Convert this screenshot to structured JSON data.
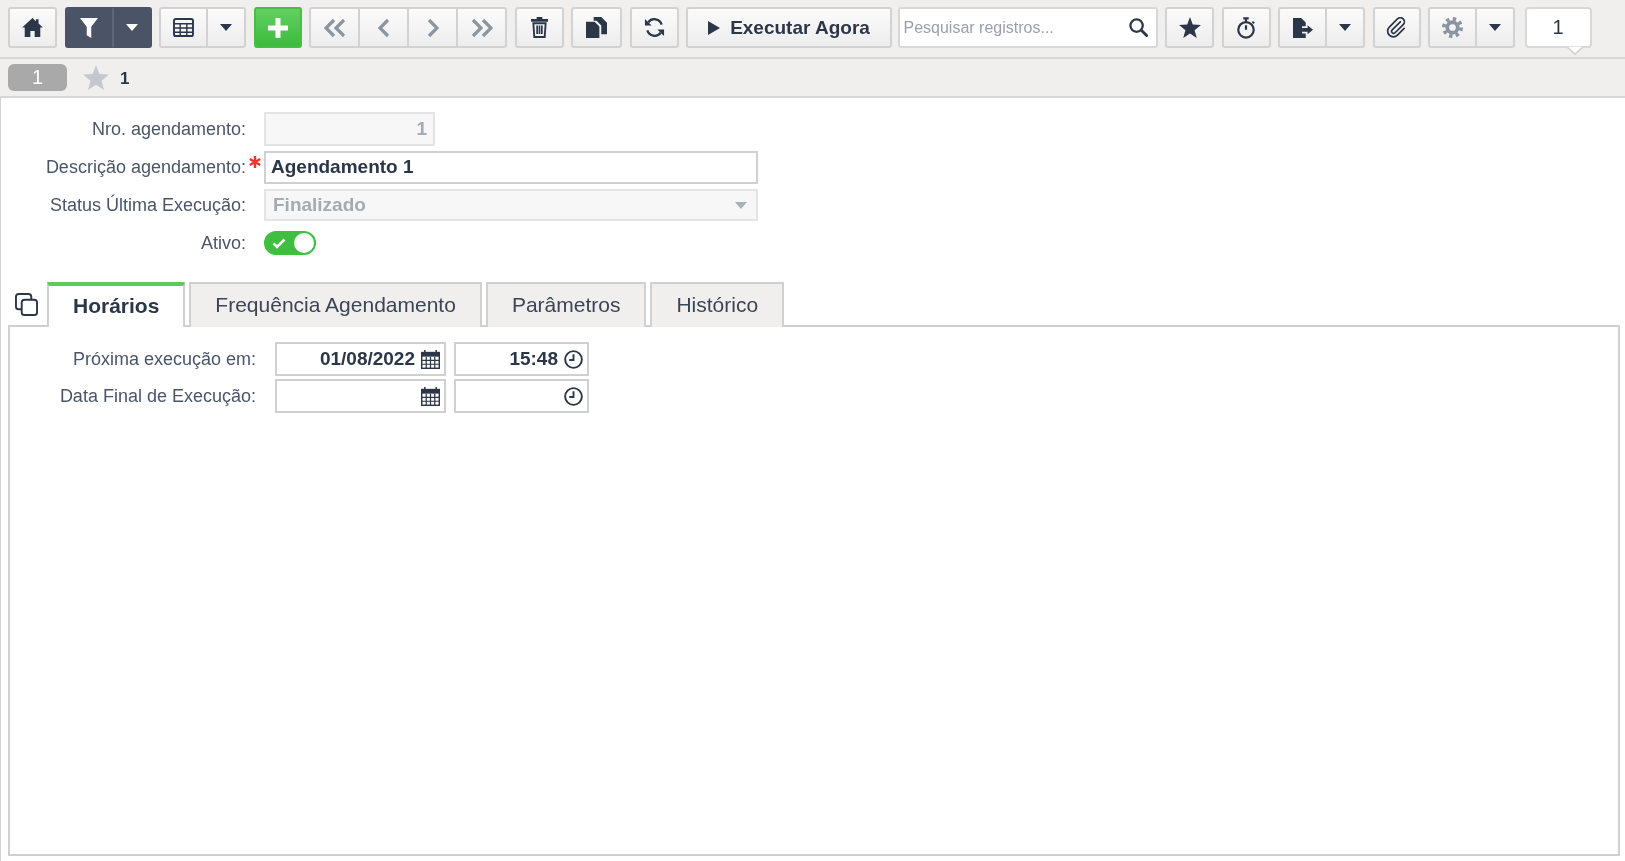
{
  "toolbar": {
    "filter_active": true,
    "run_button": {
      "label": "Executar Agora"
    },
    "search": {
      "placeholder": "Pesquisar registros..."
    },
    "record_counter": "1"
  },
  "record_bar": {
    "record_badge": "1",
    "favorites_count": "1"
  },
  "form": {
    "fields": [
      {
        "kind": "number",
        "label": "Nro. agendamento:",
        "value": "1",
        "disabled": true,
        "required": false
      },
      {
        "kind": "text",
        "label": "Descrição agendamento:",
        "value": "Agendamento 1",
        "disabled": false,
        "required": true
      },
      {
        "kind": "select",
        "label": "Status Última Execução:",
        "value": "Finalizado",
        "disabled": true,
        "required": false
      },
      {
        "kind": "toggle",
        "label": "Ativo:",
        "on": true,
        "disabled": false,
        "required": false
      }
    ]
  },
  "tabs": [
    {
      "label": "Horários",
      "selected": true
    },
    {
      "label": "Frequência Agendamento",
      "selected": false
    },
    {
      "label": "Parâmetros",
      "selected": false
    },
    {
      "label": "Histórico",
      "selected": false
    }
  ],
  "tab_panel": {
    "rows": [
      {
        "label": "Próxima execução em:",
        "date": "01/08/2022",
        "time": "15:48"
      },
      {
        "label": "Data Final de Execução:"
      }
    ]
  }
}
